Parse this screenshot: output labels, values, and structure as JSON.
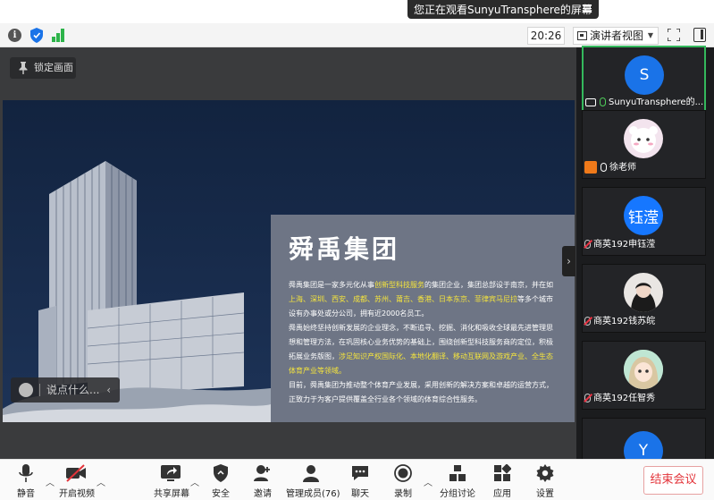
{
  "banner": {
    "viewing_label": "您正在观看SunyuTransphere的屏幕"
  },
  "toolbar": {
    "timer": "20:26",
    "view_mode": "演讲者视图"
  },
  "share": {
    "lock_label": "锁定画面",
    "chat_placeholder": "说点什么...",
    "slide": {
      "title": "舜禹集团",
      "p1_a": "舜禹集团是一家多元化从事",
      "p1_hl1": "创新型科技服务",
      "p1_b": "的集团企业，集团总部设于南京，并在如",
      "p1_hl2": "上海、深圳、西安、成都、苏州、莆吉、香港、日本东京、菲律宾马尼拉",
      "p1_c": "等多个城市设有办事处或分公司，拥有近2000名员工。",
      "p2_a": "舜禹始终坚持创新发展的企业理念，不断追寻、挖掘、消化和吸收全球最先进管理思想和管理方法，在巩固核心业务优势的基础上，围绕创新型科技服务商的定位，积极拓展业务版图，",
      "p2_hl": "涉足知识产权国际化、本地化翻译、移动互联网及游戏产业、全生态体育产业等领域。",
      "p3": "目前，舜禹集团为推动整个体育产业发展，采用创新的解决方案和卓越的运营方式，正致力于为客户提供覆盖全行业各个领域的体育综合性服务。"
    }
  },
  "participants": [
    {
      "name": "SunyuTransphere的...",
      "avatar_text": "S",
      "avatar_color": "#1a73e8",
      "status": "sharing"
    },
    {
      "name": "徐老师",
      "avatar_text": "",
      "avatar_color": "#f3e4ee",
      "status": "host"
    },
    {
      "name": "商英192申钰滢",
      "avatar_text": "钰滢",
      "avatar_color": "#1677ff",
      "status": "muted"
    },
    {
      "name": "商英192钱苏皖",
      "avatar_text": "",
      "avatar_color": "#3a3a3a",
      "status": "muted"
    },
    {
      "name": "商英192任智秀",
      "avatar_text": "",
      "avatar_color": "#bfe6d3",
      "status": "muted"
    },
    {
      "name": "",
      "avatar_text": "Y",
      "avatar_color": "#1a73e8",
      "status": "partial"
    }
  ],
  "controls": {
    "mute": "静音",
    "video": "开启视频",
    "share": "共享屏幕",
    "security": "安全",
    "invite": "邀请",
    "manage": "管理成员(76)",
    "chat": "聊天",
    "record": "录制",
    "breakout": "分组讨论",
    "apps": "应用",
    "settings": "设置",
    "end": "结束会议"
  },
  "colors": {
    "accent_green": "#34b85c",
    "end_red": "#e3343a",
    "highlight_yellow": "#f6e53c",
    "slide_bg": "#152848"
  }
}
